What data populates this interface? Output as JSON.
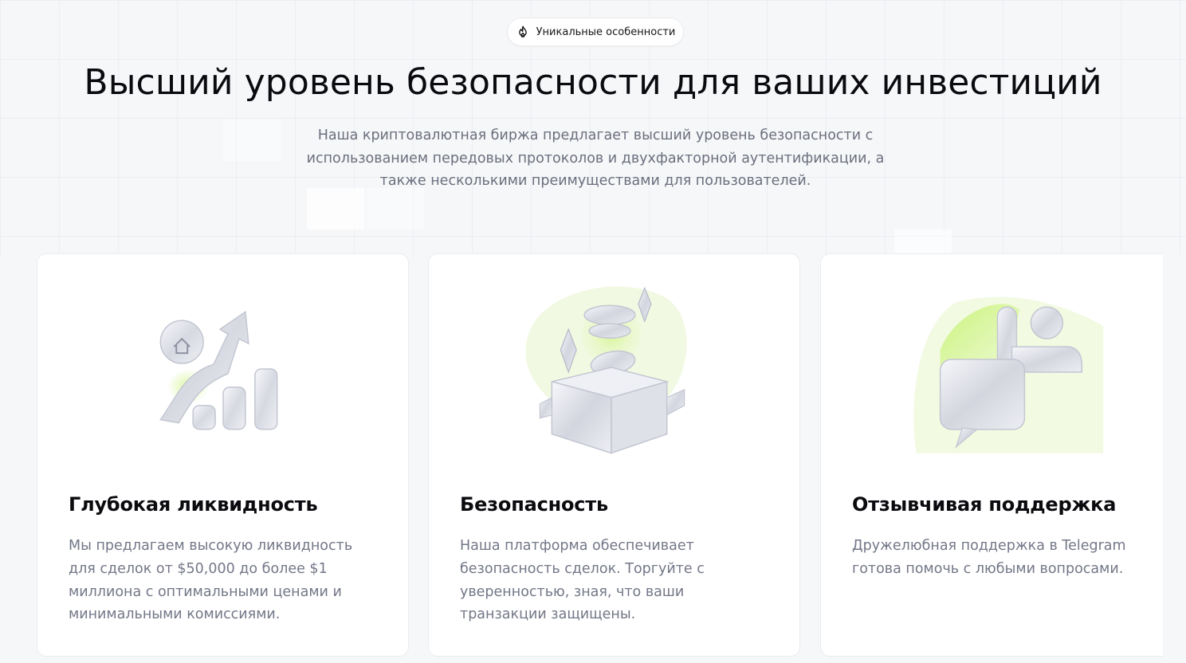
{
  "badge": {
    "icon": "flame-icon",
    "label": "Уникальные особенности"
  },
  "hero": {
    "title": "Высший уровень безопасности для ваших инвестиций",
    "subtitle": "Наша криптовалютная биржа предлагает высший уровень безопасности с использованием передовых протоколов и двухфакторной аутентификации, а также несколькими преимуществами для пользователей."
  },
  "features": [
    {
      "icon": "growth-chart-icon",
      "title": "Глубокая ликвидность",
      "text": "Мы предлагаем высокую ликвидность для сделок от $50,000 до более $1 миллиона с оптимальными ценами и минимальными комиссиями."
    },
    {
      "icon": "security-box-icon",
      "title": "Безопасность",
      "text": "Наша платформа обеспечивает безопасность сделок. Торгуйте с уверенностью, зная, что ваши транзакции защищены."
    },
    {
      "icon": "support-chat-icon",
      "title": "Отзывчивая поддержка",
      "text": "Дружелюбная поддержка в Telegram готова помочь с любыми вопросами."
    }
  ],
  "colors": {
    "accent": "#c9f26b",
    "text_primary": "#0b0b0f",
    "text_secondary": "#737787",
    "background": "#f6f7f9"
  }
}
